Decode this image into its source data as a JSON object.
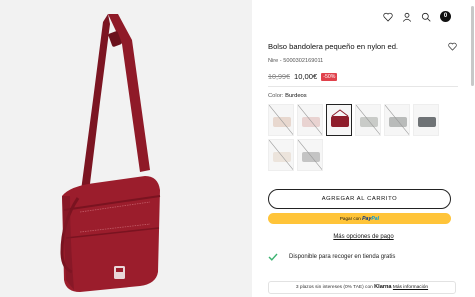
{
  "header": {
    "icons": [
      "heart-icon",
      "user-icon",
      "search-icon",
      "bag-icon"
    ],
    "cart_count": "0"
  },
  "product": {
    "title": "Bolso bandolera pequeño en nylon ed.",
    "sku": "Nire - 5000302169011",
    "old_price": "10,99€",
    "price": "10,00€",
    "discount": "-50%"
  },
  "color": {
    "label": "Color:",
    "value": "Burdeos",
    "swatches": [
      {
        "name": "beige",
        "color": "#e8d8cf",
        "unavailable": true,
        "selected": false
      },
      {
        "name": "pink",
        "color": "#e9d3d1",
        "unavailable": true,
        "selected": false
      },
      {
        "name": "burgundy",
        "color": "#8e1d2b",
        "unavailable": false,
        "selected": true
      },
      {
        "name": "grey-light",
        "color": "#c9cbc8",
        "unavailable": true,
        "selected": false
      },
      {
        "name": "grey",
        "color": "#b9bbba",
        "unavailable": true,
        "selected": false
      },
      {
        "name": "grey-dark",
        "color": "#6f7376",
        "unavailable": false,
        "selected": false
      },
      {
        "name": "ivory",
        "color": "#ece4dc",
        "unavailable": true,
        "selected": false
      },
      {
        "name": "silver",
        "color": "#c4c4c4",
        "unavailable": true,
        "selected": false
      }
    ]
  },
  "actions": {
    "add_to_cart": "AGREGAR AL CARRITO",
    "pay_with": "Pagar con",
    "paypal_a": "Pay",
    "paypal_b": "Pal",
    "more_payment": "Más opciones de pago"
  },
  "pickup": {
    "text": "Disponible para recoger en tienda gratis"
  },
  "klarna": {
    "text": "3 plazos sin intereses (0% TAE) con",
    "brand": "Klarna",
    "link": "Más información"
  },
  "colors": {
    "bag": "#9b1d2c",
    "accent_green": "#3cb371",
    "discount_red": "#e0414b",
    "paypal_yellow": "#ffc439"
  }
}
